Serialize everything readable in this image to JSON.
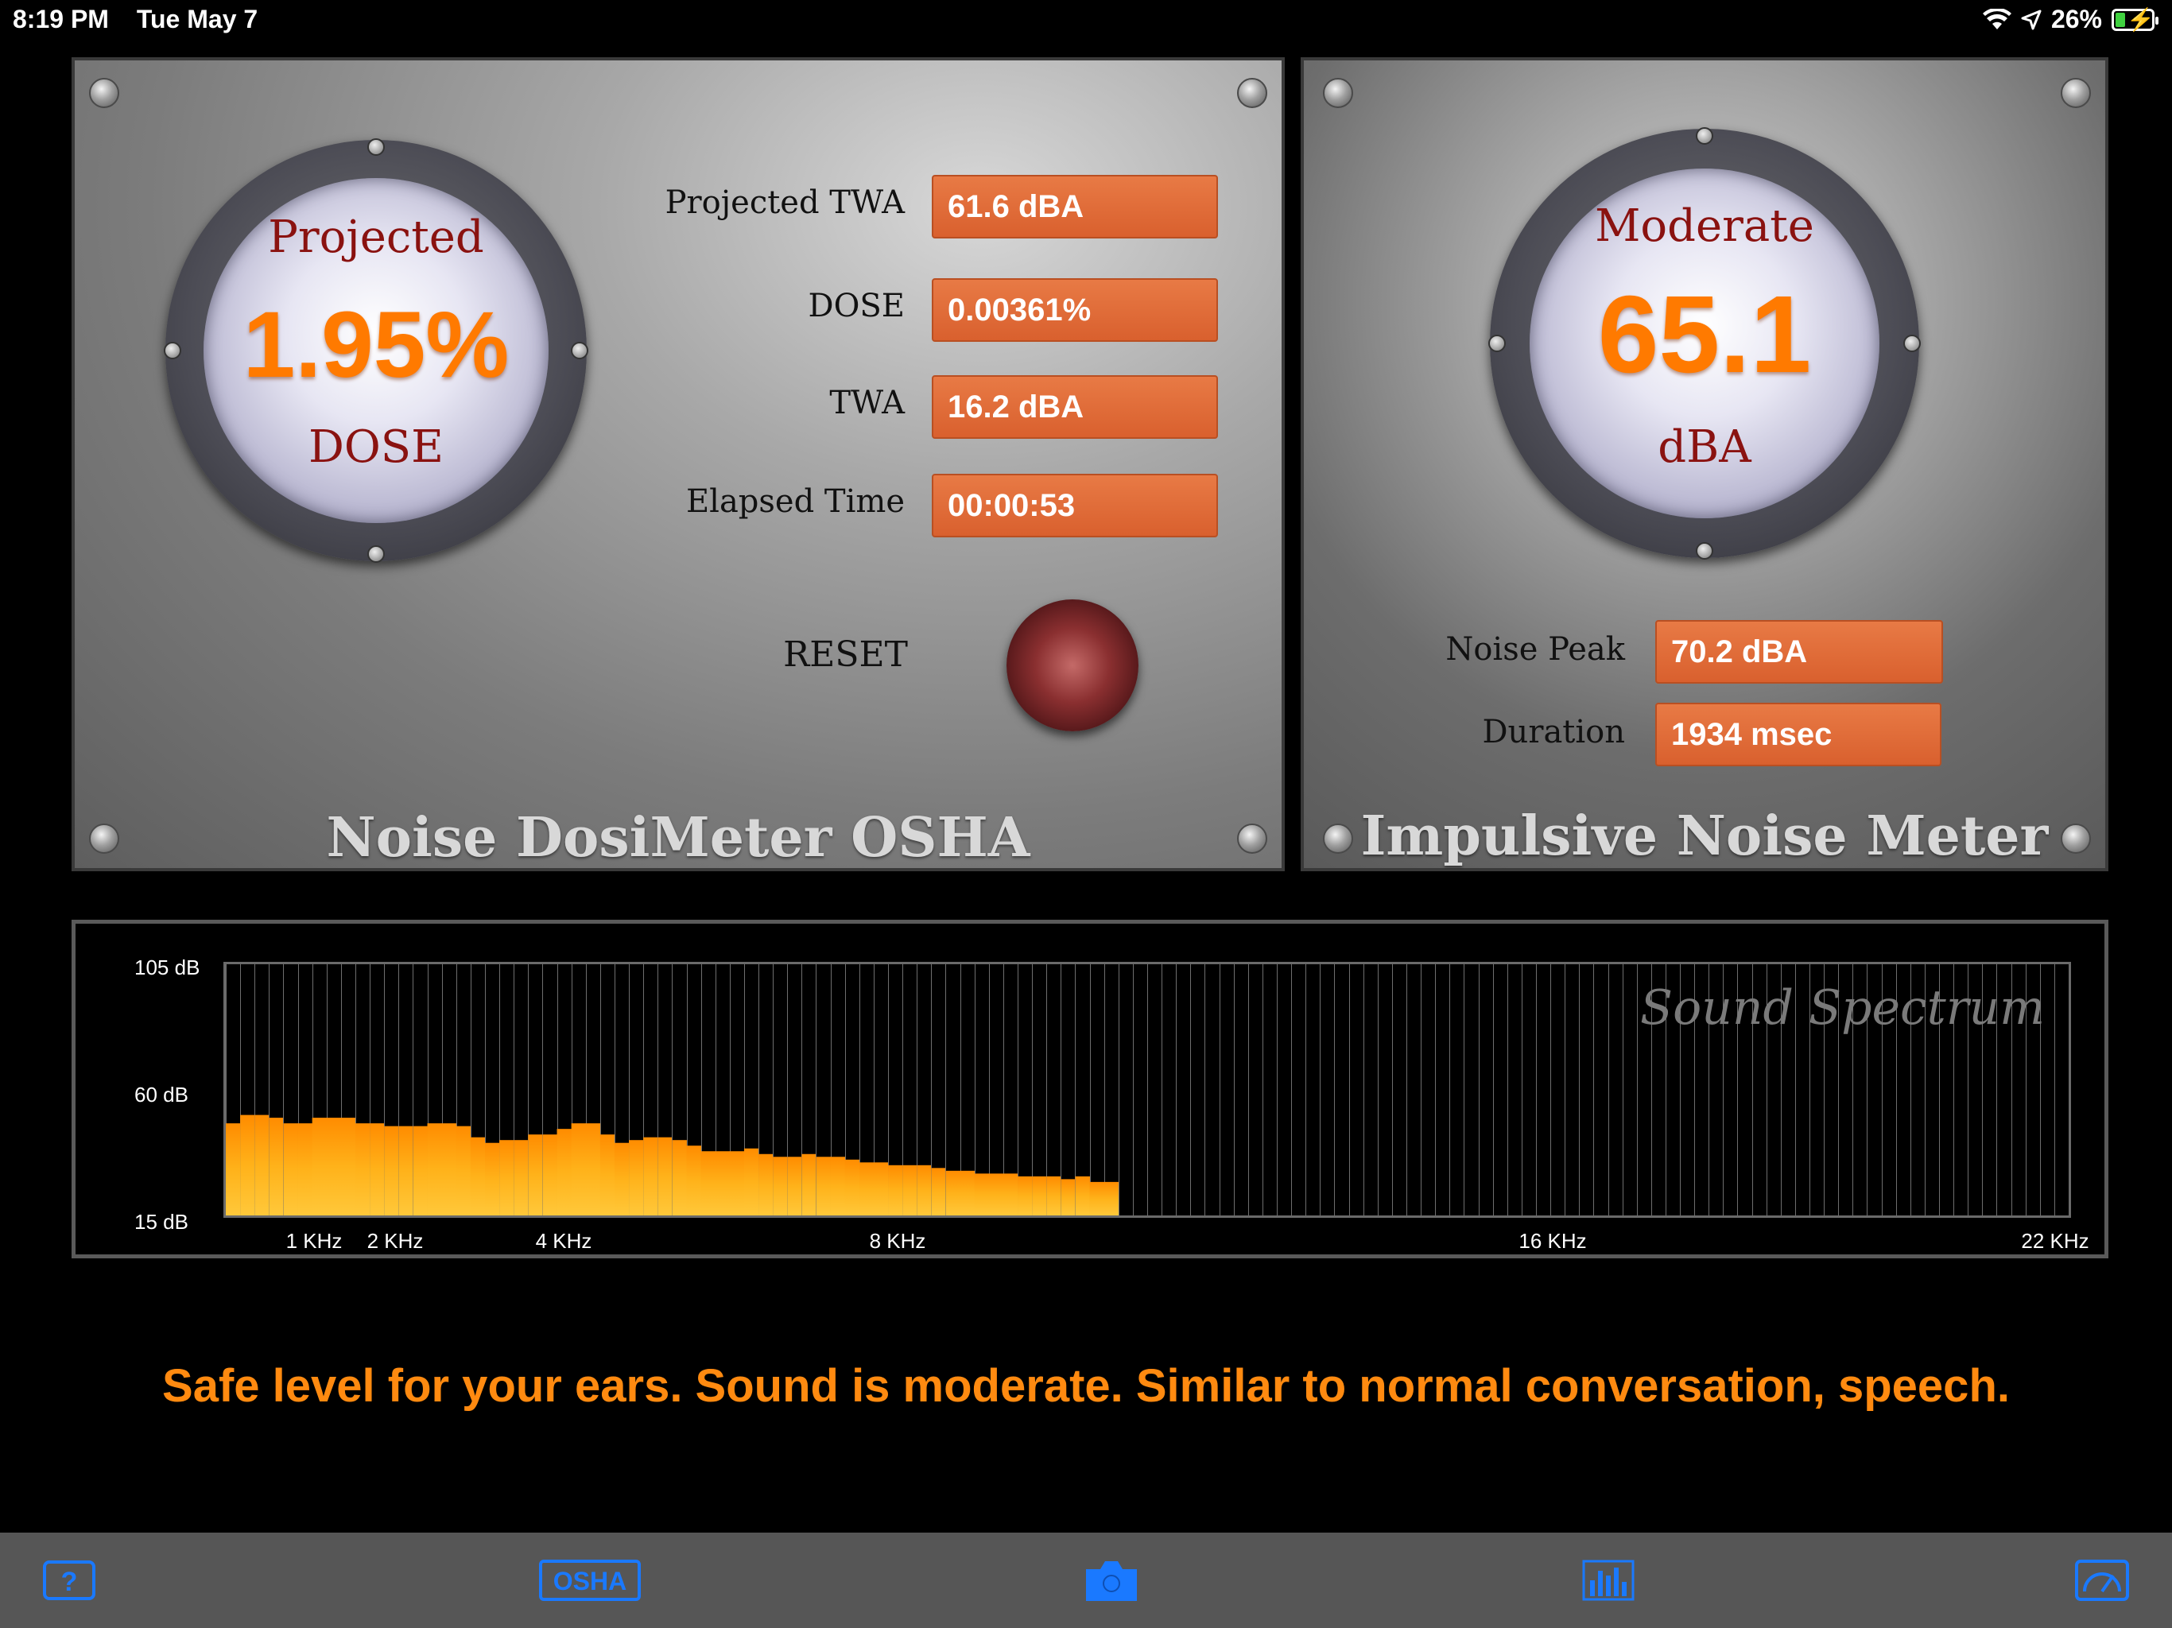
{
  "status": {
    "time": "8:19 PM",
    "date": "Tue May 7",
    "battery": "26%",
    "battery_level": 0.26
  },
  "dosimeter": {
    "title": "Noise DosiMeter OSHA",
    "gauge": {
      "top": "Projected",
      "value": "1.95%",
      "bottom": "DOSE"
    },
    "fields": [
      {
        "label": "Projected TWA",
        "value": "61.6 dBA"
      },
      {
        "label": "DOSE",
        "value": "0.00361%"
      },
      {
        "label": "TWA",
        "value": "16.2 dBA"
      },
      {
        "label": "Elapsed Time",
        "value": "00:00:53"
      }
    ],
    "reset_label": "RESET"
  },
  "impulsive": {
    "title": "Impulsive Noise Meter",
    "gauge": {
      "top": "Moderate",
      "value": "65.1",
      "bottom": "dBA"
    },
    "fields": [
      {
        "label": "Noise Peak",
        "value": "70.2 dBA"
      },
      {
        "label": "Duration",
        "value": "1934 msec"
      }
    ]
  },
  "spectrum": {
    "watermark": "Sound Spectrum",
    "y_labels": [
      "105 dB",
      "60 dB",
      "15 dB"
    ],
    "x_labels": [
      "1 KHz",
      "2 KHz",
      "4 KHz",
      "8 KHz",
      "16 KHz",
      "22 KHz"
    ],
    "ylim": [
      15,
      105
    ],
    "bar_count": 128,
    "levels_db": [
      48,
      51,
      51,
      50,
      48,
      48,
      50,
      50,
      50,
      48,
      48,
      47,
      47,
      47,
      48,
      48,
      47,
      43,
      41,
      42,
      42,
      44,
      44,
      46,
      48,
      48,
      44,
      41,
      42,
      43,
      43,
      42,
      40,
      38,
      38,
      38,
      39,
      37,
      36,
      36,
      37,
      36,
      36,
      35,
      34,
      34,
      33,
      33,
      33,
      32,
      31,
      31,
      30,
      30,
      30,
      29,
      29,
      29,
      28,
      29,
      27,
      27,
      27,
      26,
      26,
      26,
      24,
      25,
      24,
      23,
      23,
      22,
      22,
      21,
      21,
      20,
      20,
      19,
      18,
      18,
      17,
      17,
      17,
      16,
      16,
      16,
      16,
      16,
      16,
      16,
      16,
      16,
      16,
      16,
      16,
      16,
      16,
      16,
      16,
      16,
      16,
      16,
      16,
      16,
      16,
      16,
      16,
      16,
      16,
      16,
      16,
      16,
      16,
      16,
      16,
      16,
      16,
      16,
      16,
      16,
      16,
      16,
      16,
      16,
      16,
      16,
      16,
      16
    ],
    "active_bars": 62
  },
  "advice": "Safe level for your ears. Sound is moderate. Similar to normal conversation, speech.",
  "tabs": [
    {
      "name": "help",
      "label": "?"
    },
    {
      "name": "osha",
      "label": "OSHA"
    },
    {
      "name": "camera",
      "label": ""
    },
    {
      "name": "spectrum",
      "label": ""
    },
    {
      "name": "meter",
      "label": ""
    }
  ]
}
